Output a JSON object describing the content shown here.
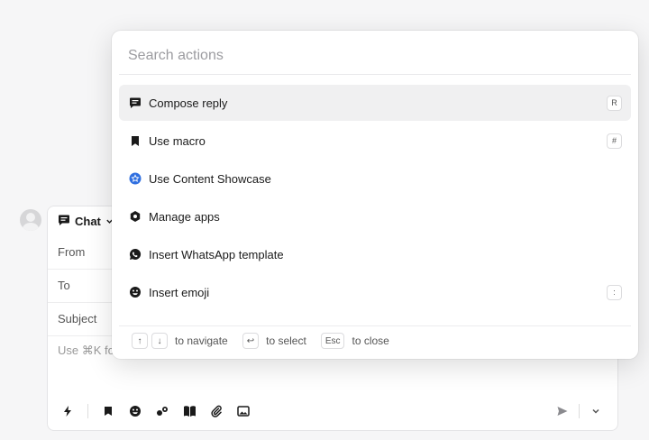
{
  "composer": {
    "channel_label": "Chat",
    "fields": {
      "from": "From",
      "to": "To",
      "subject": "Subject"
    },
    "body_hint": "Use ⌘K fo"
  },
  "palette": {
    "search_placeholder": "Search actions",
    "actions": [
      {
        "label": "Compose reply",
        "icon": "compose-icon",
        "shortcut": "R",
        "active": true
      },
      {
        "label": "Use macro",
        "icon": "bookmark-icon",
        "shortcut": "#"
      },
      {
        "label": "Use Content Showcase",
        "icon": "showcase-star-icon",
        "shortcut": ""
      },
      {
        "label": "Manage apps",
        "icon": "hexagon-icon",
        "shortcut": ""
      },
      {
        "label": "Insert WhatsApp template",
        "icon": "whatsapp-icon",
        "shortcut": ""
      },
      {
        "label": "Insert emoji",
        "icon": "emoji-icon",
        "shortcut": ":"
      }
    ],
    "footer": {
      "up_key": "↑",
      "down_key": "↓",
      "navigate_text": "to navigate",
      "enter_key": "↩",
      "select_text": "to select",
      "esc_key": "Esc",
      "close_text": "to close"
    }
  },
  "colors": {
    "accent_blue": "#2f6fe0",
    "active_row": "#f0f0f1"
  }
}
